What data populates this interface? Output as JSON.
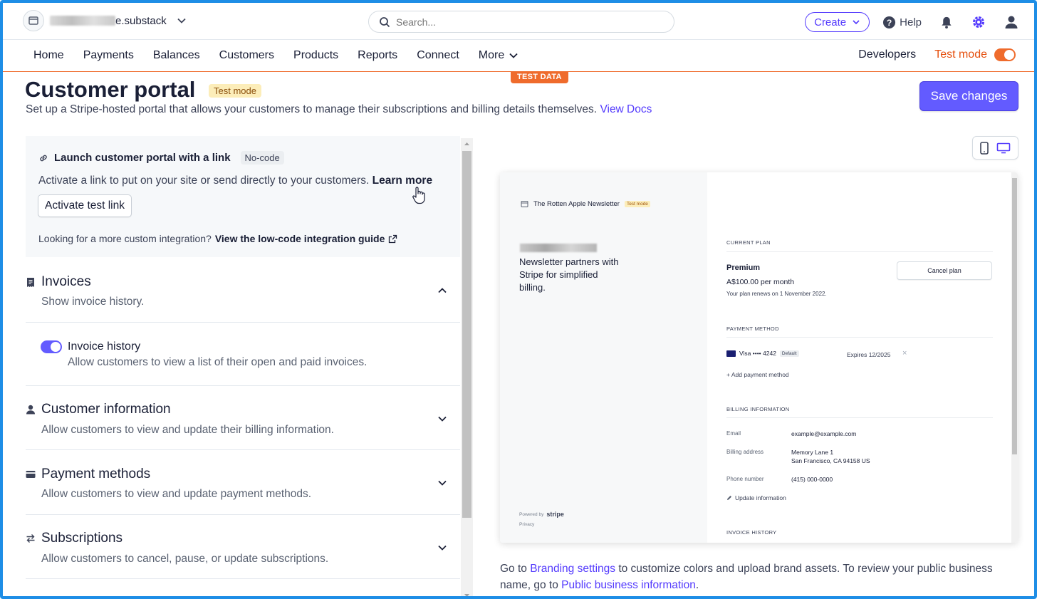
{
  "account": {
    "name_suffix": "e.substack"
  },
  "search": {
    "placeholder": "Search..."
  },
  "topbar": {
    "create_label": "Create",
    "help_label": "Help"
  },
  "nav": {
    "items": [
      "Home",
      "Payments",
      "Balances",
      "Customers",
      "Products",
      "Reports",
      "Connect",
      "More"
    ],
    "developers": "Developers",
    "test_mode": "Test mode"
  },
  "test_data_tab": "TEST DATA",
  "header": {
    "title": "Customer portal",
    "badge": "Test mode",
    "subtitle": "Set up a Stripe-hosted portal that allows your customers to manage their subscriptions and billing details themselves.",
    "view_docs": "View Docs",
    "save_label": "Save changes"
  },
  "launch": {
    "title": "Launch customer portal with a link",
    "badge": "No-code",
    "desc": "Activate a link to put on your site or send directly to your customers.",
    "learn_more": "Learn more",
    "activate_label": "Activate test link",
    "foot": "Looking for a more custom integration?",
    "foot_link": "View the low-code integration guide"
  },
  "sections": {
    "invoices": {
      "title": "Invoices",
      "desc": "Show invoice history."
    },
    "invoice_history": {
      "title": "Invoice history",
      "desc": "Allow customers to view a list of their open and paid invoices."
    },
    "customer_info": {
      "title": "Customer information",
      "desc": "Allow customers to view and update their billing information."
    },
    "payment_methods": {
      "title": "Payment methods",
      "desc": "Allow customers to view and update payment methods."
    },
    "subscriptions": {
      "title": "Subscriptions",
      "desc": "Allow customers to cancel, pause, or update subscriptions."
    }
  },
  "preview": {
    "brand": "The Rotten Apple Newsletter",
    "brand_badge": "Test mode",
    "tagline": "Newsletter partners with Stripe for simplified billing.",
    "powered_by": "Powered by",
    "stripe": "stripe",
    "privacy": "Privacy",
    "current_plan_h": "CURRENT PLAN",
    "plan_name": "Premium",
    "plan_price": "A$100.00 per month",
    "plan_renew": "Your plan renews on 1 November 2022.",
    "cancel_plan": "Cancel plan",
    "payment_method_h": "PAYMENT METHOD",
    "card": "Visa •••• 4242",
    "card_default": "Default",
    "card_expires": "Expires 12/2025",
    "add_payment": "Add payment method",
    "billing_info_h": "BILLING INFORMATION",
    "email_label": "Email",
    "email_value": "example@example.com",
    "address_label": "Billing address",
    "address_line1": "Memory Lane 1",
    "address_line2": "San Francisco, CA 94158 US",
    "phone_label": "Phone number",
    "phone_value": "(415) 000-0000",
    "update_info": "Update information",
    "invoice_history_h": "INVOICE HISTORY"
  },
  "branding_note": {
    "pre": "Go to",
    "link1": "Branding settings",
    "mid": "to customize colors and upload brand assets. To review your public business name, go to",
    "link2": "Public business information",
    "end": "."
  },
  "colors": {
    "accent": "#635bff",
    "test_mode": "#ef6b2c",
    "frame": "#1e8ee6"
  }
}
